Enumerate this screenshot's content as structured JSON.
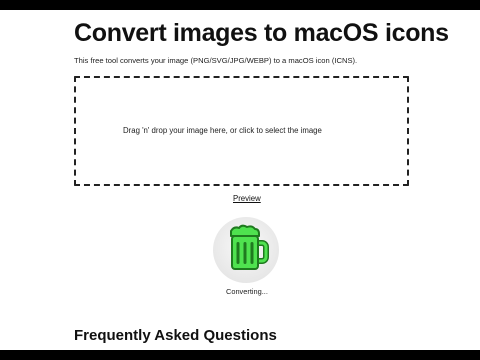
{
  "header": {
    "title": "Convert images to macOS icons",
    "intro": "This free tool converts your image (PNG/SVG/JPG/WEBP) to a macOS icon (ICNS)."
  },
  "dropzone": {
    "text": "Drag 'n' drop your image here, or click to select the image"
  },
  "preview": {
    "link_label": "Preview",
    "icon": "beer-mug-icon",
    "status": "Converting..."
  },
  "faq": {
    "heading": "Frequently Asked Questions"
  },
  "colors": {
    "icon_green": "#4fe24f",
    "icon_outline": "#1f7a1f",
    "icon_bg": "#f2f2f2"
  }
}
